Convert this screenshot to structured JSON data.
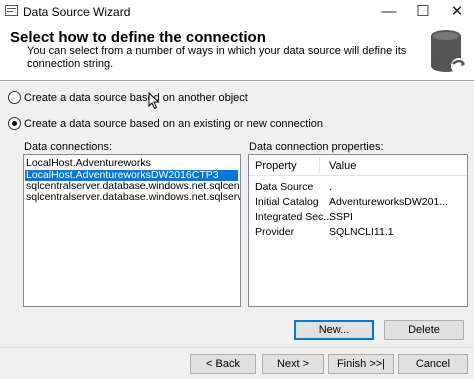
{
  "window": {
    "title": "Data Source Wizard",
    "minimize_glyph": "—",
    "maximize_glyph": "☐",
    "close_glyph": "✕"
  },
  "header": {
    "title": "Select how to define the connection",
    "description": "You can select from a number of ways in which your data source will define its connection string."
  },
  "options": {
    "another_object": "Create a data source based on another object",
    "existing_or_new": "Create a data source based on an existing or new connection",
    "selected": "existing_or_new"
  },
  "connections": {
    "label": "Data connections:",
    "items": [
      "LocalHost.Adventureworks",
      "LocalHost.AdventureworksDW2016CTP3",
      "sqlcentralserver.database.windows.net.sqlcentralwar",
      "sqlcentralserver.database.windows.net.sqlservercent"
    ],
    "selected_index": 1
  },
  "properties": {
    "label": "Data connection properties:",
    "columns": [
      "Property",
      "Value"
    ],
    "rows": [
      {
        "property": "Data Source",
        "value": "."
      },
      {
        "property": "Initial Catalog",
        "value": "AdventureworksDW201..."
      },
      {
        "property": "Integrated Sec...",
        "value": "SSPI"
      },
      {
        "property": "Provider",
        "value": "SQLNCLI11.1"
      }
    ]
  },
  "buttons": {
    "new": "New...",
    "delete": "Delete",
    "back": "< Back",
    "next": "Next >",
    "finish": "Finish >>|",
    "cancel": "Cancel"
  },
  "colors": {
    "selection": "#0078d7",
    "dialog_background": "#f0f0f0",
    "focus_border": "#0078d7"
  },
  "icons": [
    "app-icon",
    "database-icon",
    "mouse-cursor-icon"
  ]
}
